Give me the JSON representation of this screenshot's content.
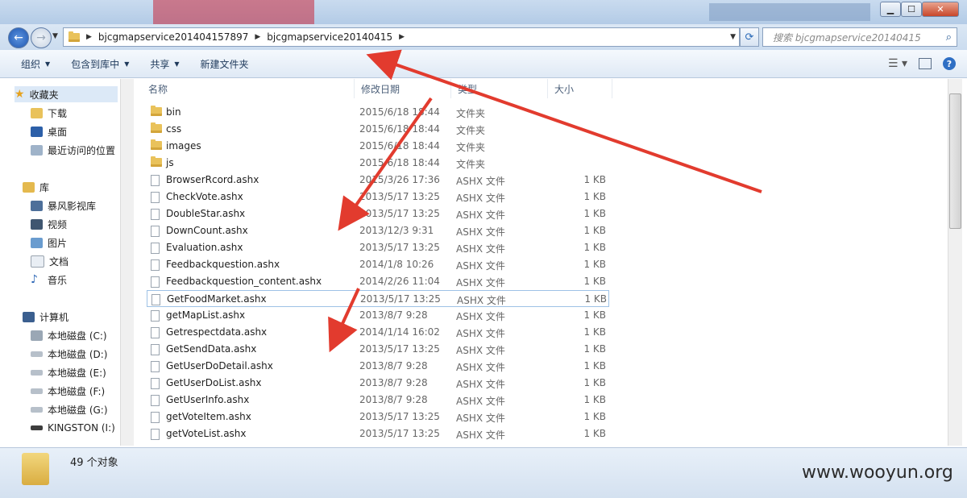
{
  "address": {
    "crumbs": [
      "bjcgmapservice201404157897",
      "bjcgmapservice20140415"
    ]
  },
  "search": {
    "placeholder": "搜索 bjcgmapservice20140415"
  },
  "toolbar": {
    "organize": "组织",
    "include_in_library": "包含到库中",
    "share": "共享",
    "new_folder": "新建文件夹"
  },
  "nav": {
    "favorites": "收藏夹",
    "downloads": "下载",
    "desktop": "桌面",
    "recent": "最近访问的位置",
    "libraries": "库",
    "baofeng": "暴风影视库",
    "videos": "视频",
    "pictures": "图片",
    "documents": "文档",
    "music": "音乐",
    "computer": "计算机",
    "disk_c": "本地磁盘 (C:)",
    "disk_d": "本地磁盘 (D:)",
    "disk_e": "本地磁盘 (E:)",
    "disk_f": "本地磁盘 (F:)",
    "disk_g": "本地磁盘 (G:)",
    "kingston": "KINGSTON (I:)"
  },
  "columns": {
    "name": "名称",
    "date": "修改日期",
    "type": "类型",
    "size": "大小"
  },
  "files": [
    {
      "name": "bin",
      "date": "2015/6/18 18:44",
      "type": "文件夹",
      "size": "",
      "folder": true
    },
    {
      "name": "css",
      "date": "2015/6/18 18:44",
      "type": "文件夹",
      "size": "",
      "folder": true
    },
    {
      "name": "images",
      "date": "2015/6/18 18:44",
      "type": "文件夹",
      "size": "",
      "folder": true
    },
    {
      "name": "js",
      "date": "2015/6/18 18:44",
      "type": "文件夹",
      "size": "",
      "folder": true
    },
    {
      "name": "BrowserRcord.ashx",
      "date": "2015/3/26 17:36",
      "type": "ASHX 文件",
      "size": "1 KB"
    },
    {
      "name": "CheckVote.ashx",
      "date": "2013/5/17 13:25",
      "type": "ASHX 文件",
      "size": "1 KB"
    },
    {
      "name": "DoubleStar.ashx",
      "date": "2013/5/17 13:25",
      "type": "ASHX 文件",
      "size": "1 KB"
    },
    {
      "name": "DownCount.ashx",
      "date": "2013/12/3 9:31",
      "type": "ASHX 文件",
      "size": "1 KB"
    },
    {
      "name": "Evaluation.ashx",
      "date": "2013/5/17 13:25",
      "type": "ASHX 文件",
      "size": "1 KB"
    },
    {
      "name": "Feedbackquestion.ashx",
      "date": "2014/1/8 10:26",
      "type": "ASHX 文件",
      "size": "1 KB"
    },
    {
      "name": "Feedbackquestion_content.ashx",
      "date": "2014/2/26 11:04",
      "type": "ASHX 文件",
      "size": "1 KB"
    },
    {
      "name": "GetFoodMarket.ashx",
      "date": "2013/5/17 13:25",
      "type": "ASHX 文件",
      "size": "1 KB",
      "selected": true
    },
    {
      "name": "getMapList.ashx",
      "date": "2013/8/7 9:28",
      "type": "ASHX 文件",
      "size": "1 KB"
    },
    {
      "name": "Getrespectdata.ashx",
      "date": "2014/1/14 16:02",
      "type": "ASHX 文件",
      "size": "1 KB"
    },
    {
      "name": "GetSendData.ashx",
      "date": "2013/5/17 13:25",
      "type": "ASHX 文件",
      "size": "1 KB"
    },
    {
      "name": "GetUserDoDetail.ashx",
      "date": "2013/8/7 9:28",
      "type": "ASHX 文件",
      "size": "1 KB"
    },
    {
      "name": "GetUserDoList.ashx",
      "date": "2013/8/7 9:28",
      "type": "ASHX 文件",
      "size": "1 KB"
    },
    {
      "name": "GetUserInfo.ashx",
      "date": "2013/8/7 9:28",
      "type": "ASHX 文件",
      "size": "1 KB"
    },
    {
      "name": "getVoteItem.ashx",
      "date": "2013/5/17 13:25",
      "type": "ASHX 文件",
      "size": "1 KB"
    },
    {
      "name": "getVoteList.ashx",
      "date": "2013/5/17 13:25",
      "type": "ASHX 文件",
      "size": "1 KB"
    }
  ],
  "status": {
    "count": "49 个对象"
  },
  "watermark": "www.wooyun.org",
  "colors": {
    "annotation_arrow": "#e23b2e",
    "folder": "#e9c25b"
  }
}
